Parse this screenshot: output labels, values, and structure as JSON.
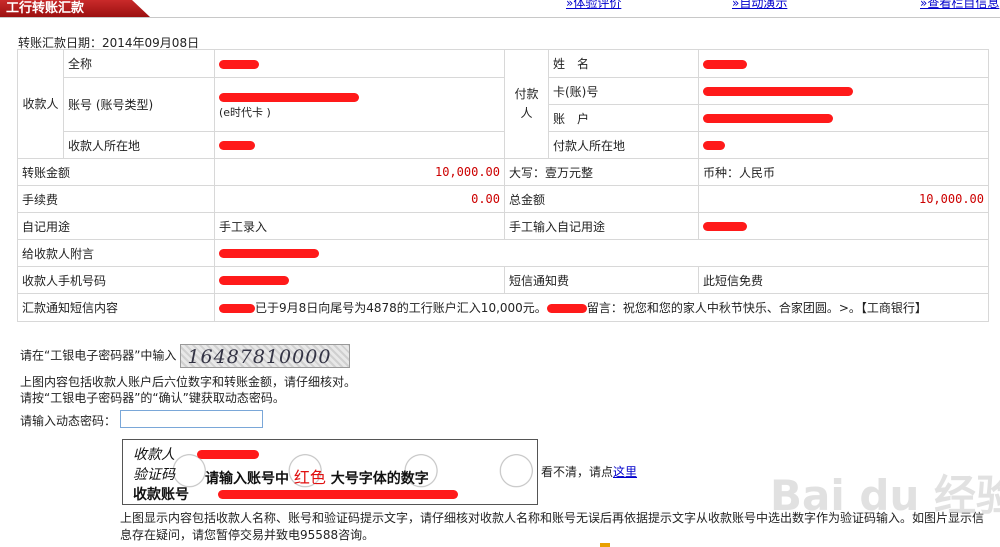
{
  "header": {
    "title": "工行转账汇款",
    "links": [
      "»体验评价",
      "»自动演示",
      "»查看栏目信息"
    ]
  },
  "transfer_date": "转账汇款日期：2014年09月08日",
  "payee": {
    "group_label": "收款人",
    "fullname_label": "全称",
    "account_label": "账号 (账号类型)",
    "account_type": "(e时代卡 )",
    "location_label": "收款人所在地"
  },
  "payer": {
    "group_label": "付款人",
    "name_label": "姓　名",
    "card_label": "卡(账)号",
    "account_label": "账　户",
    "location_label": "付款人所在地"
  },
  "amount": {
    "label": "转账金额",
    "value": "10,000.00",
    "uppercase": "大写：壹万元整",
    "currency": "币种：人民币"
  },
  "fee": {
    "label": "手续费",
    "value": "0.00",
    "total_label": "总金额",
    "total_value": "10,000.00"
  },
  "memo": {
    "label": "自记用途",
    "value": "手工录入",
    "manual_label": "手工输入自记用途"
  },
  "note": {
    "label": "给收款人附言"
  },
  "mobile": {
    "label": "收款人手机号码",
    "sms_fee_label": "短信通知费",
    "sms_fee_value": "此短信免费"
  },
  "sms": {
    "label": "汇款通知短信内容",
    "part1": "已于9月8日向尾号为4878的工行账户汇入10,000元。",
    "part2": "留言：祝您和您的家人中秋节快乐、合家团圆。>。【工商银行】"
  },
  "instructions": {
    "line1": "请在“工银电子密码器”中输入",
    "captcha_code": "16487810000",
    "line2": "上图内容包括收款人账户后六位数字和转账金额，请仔细核对。",
    "line3": "请按“工银电子密码器”的“确认”键获取动态密码。",
    "otp_label": "请输入动态密码："
  },
  "hint_image": {
    "label1": "收款人",
    "label2": "验证码",
    "label3": "收款账号",
    "main_prefix": "请输入账号中",
    "main_red": "红色",
    "main_suffix": "大号字体的数字"
  },
  "reload": {
    "text": "看不清，请点",
    "link": "这里"
  },
  "footer_text": "上图显示内容包括收款人名称、账号和验证码提示文字，请仔细核对收款人名称和账号无误后再依据提示文字从收款账号中选出数字作为验证码输入。如图片显示信息存在疑问，请您暂停交易并致电95588咨询。",
  "watermark": "Bai du 经验",
  "colors": {
    "brand_red": "#c92a2a",
    "amount_red": "#cc0000",
    "link_blue": "#0000cc",
    "redaction": "#ff1a1a"
  }
}
